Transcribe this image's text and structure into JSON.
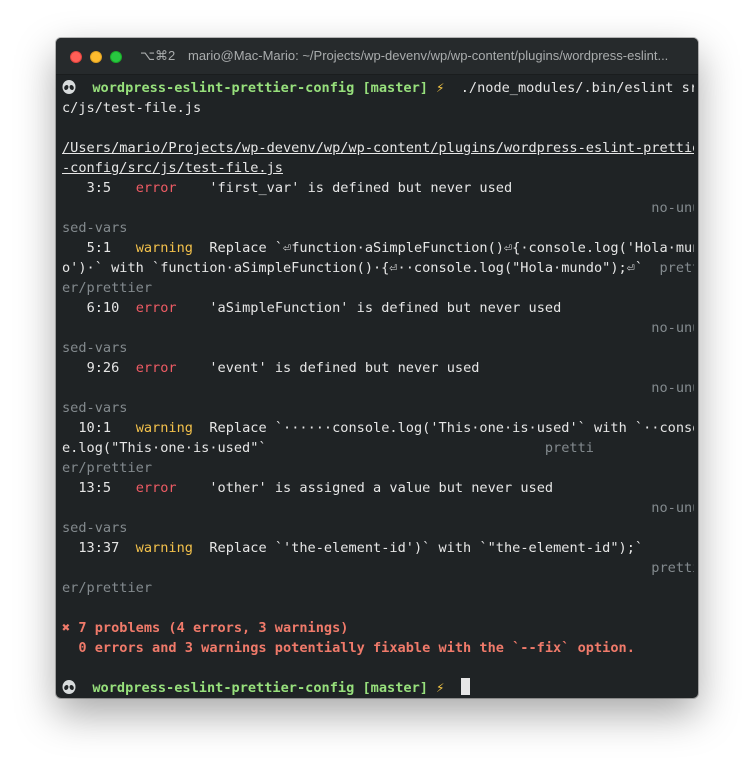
{
  "window": {
    "title_shortcut": "⌥⌘2",
    "title": "mario@Mac-Mario: ~/Projects/wp-devenv/wp/wp-content/plugins/wordpress-eslint..."
  },
  "prompt1": {
    "dir": "wordpress-eslint-prettier-config",
    "branch": "[master]",
    "bolt": "⚡",
    "command_line1": "./node_modules/.bin/eslint sr",
    "command_line2": "c/js/test-file.js"
  },
  "report": {
    "file_line1": "/Users/mario/Projects/wp-devenv/wp/wp-content/plugins/wordpress-eslint-prettier",
    "file_line2": "-config/src/js/test-file.js",
    "messages": [
      {
        "pos": "3:5",
        "level": "error",
        "text": "'first_var' is defined but never used",
        "rule_a": "no-unu",
        "rule_b": "sed-vars"
      },
      {
        "pos": "5:1",
        "level": "warning",
        "text": "Replace `⏎function·aSimpleFunction()⏎{·console.log('Hola·mundo",
        "text2": "o')·` with `function·aSimpleFunction()·{⏎··console.log(\"Hola·mundo\");⏎`",
        "rule_a": "pretti",
        "rule_b": "er/prettier"
      },
      {
        "pos": "6:10",
        "level": "error",
        "text": "'aSimpleFunction' is defined but never used",
        "rule_a": "no-unu",
        "rule_b": "sed-vars"
      },
      {
        "pos": "9:26",
        "level": "error",
        "text": "'event' is defined but never used",
        "rule_a": "no-unu",
        "rule_b": "sed-vars"
      },
      {
        "pos": "10:1",
        "level": "warning",
        "text": "Replace `······console.log('This·one·is·used'` with `··consol",
        "text2": "e.log(\"This·one·is·used\"`",
        "rule_a": "pretti",
        "rule_b": "er/prettier"
      },
      {
        "pos": "13:5",
        "level": "error",
        "text": "'other' is assigned a value but never used",
        "rule_a": "no-unu",
        "rule_b": "sed-vars"
      },
      {
        "pos": "13:37",
        "level": "warning",
        "text": "Replace `'the-element-id')` with `\"the-element-id\");`",
        "rule_a": "pretti",
        "rule_b": "er/prettier"
      }
    ],
    "summary_line1": "✖ 7 problems (4 errors, 3 warnings)",
    "summary_line2": "  0 errors and 3 warnings potentially fixable with the `--fix` option."
  },
  "prompt2": {
    "dir": "wordpress-eslint-prettier-config",
    "branch": "[master]",
    "bolt": "⚡"
  },
  "colors": {
    "background": "#1f2325",
    "prompt_green": "#97e07c",
    "error_red": "#ee5b64",
    "warning_yellow": "#f3c14b",
    "summary_salmon": "#f07a6a",
    "rule_gray": "#838a8e"
  },
  "icons": {
    "prompt": "alien-icon",
    "bolt": "lightning-bolt-icon"
  }
}
